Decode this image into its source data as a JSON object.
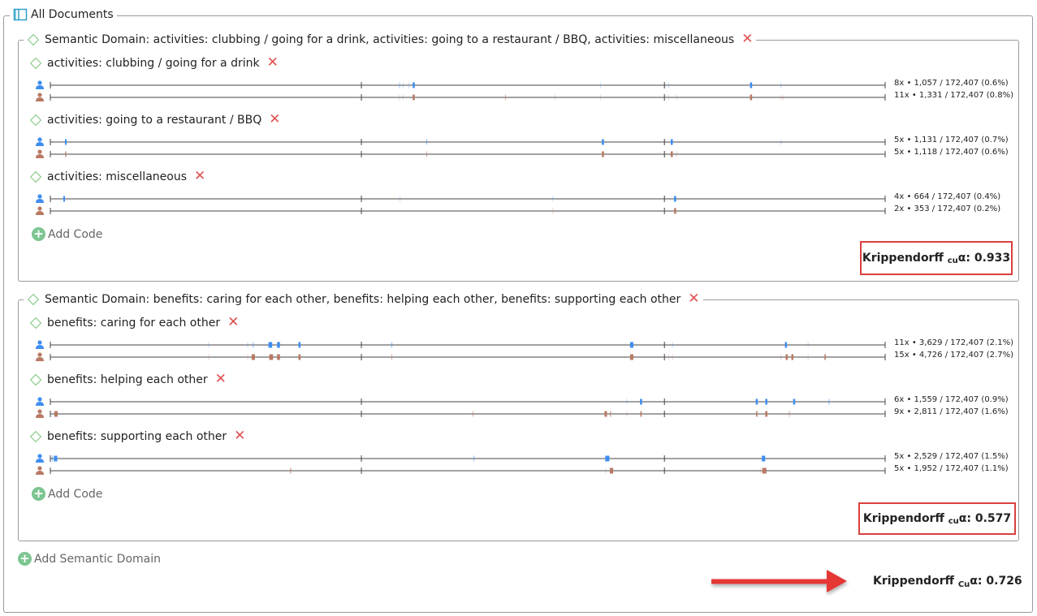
{
  "header": {
    "title": "All Documents"
  },
  "domains": [
    {
      "title": "Semantic Domain: activities: clubbing / going for a drink, activities: going to a restaurant / BBQ, activities: miscellaneous",
      "codes": [
        {
          "title": "activities: clubbing / going for a drink",
          "rows": [
            {
              "coder": "coder-blue",
              "stat": "8x • 1,057 / 172,407 (0.6%)",
              "marks": [
                [
                  0.4183,
                  0.0015,
                  "l"
                ],
                [
                  0.4226,
                  0.001,
                  "l"
                ],
                [
                  0.4291,
                  0.001,
                  "l"
                ],
                [
                  0.4353,
                  0.0025,
                  "d"
                ],
                [
                  0.6589,
                  0.001,
                  "l"
                ],
                [
                  0.7406,
                  0.001,
                  "l"
                ],
                [
                  0.8394,
                  0.0025,
                  "d"
                ],
                [
                  0.8753,
                  0.001,
                  "l"
                ]
              ]
            },
            {
              "coder": "coder-brown",
              "stat": "11x • 1,331 / 172,407 (0.8%)",
              "marks": [
                [
                  0.4183,
                  0.001,
                  "l"
                ],
                [
                  0.4226,
                  0.001,
                  "l"
                ],
                [
                  0.4353,
                  0.0025,
                  "d"
                ],
                [
                  0.5453,
                  0.001,
                  "m"
                ],
                [
                  0.6044,
                  0.001,
                  "l"
                ],
                [
                  0.6589,
                  0.001,
                  "l"
                ],
                [
                  0.7406,
                  0.001,
                  "l"
                ],
                [
                  0.7503,
                  0.001,
                  "l"
                ],
                [
                  0.8394,
                  0.0025,
                  "d"
                ],
                [
                  0.8753,
                  0.001,
                  "l"
                ],
                [
                  0.8782,
                  0.001,
                  "l"
                ]
              ]
            }
          ]
        },
        {
          "title": "activities: going to a restaurant / BBQ",
          "rows": [
            {
              "coder": "coder-blue",
              "stat": "5x • 1,131 / 172,407 (0.7%)",
              "marks": [
                [
                  0.0185,
                  0.002,
                  "d"
                ],
                [
                  0.4508,
                  0.001,
                  "m"
                ],
                [
                  0.6619,
                  0.0025,
                  "d"
                ],
                [
                  0.7444,
                  0.0025,
                  "d"
                ],
                [
                  0.8752,
                  0.001,
                  "l"
                ]
              ]
            },
            {
              "coder": "coder-brown",
              "stat": "5x • 1,118 / 172,407 (0.6%)",
              "marks": [
                [
                  0.0185,
                  0.002,
                  "m"
                ],
                [
                  0.4508,
                  0.001,
                  "m"
                ],
                [
                  0.6619,
                  0.0025,
                  "d"
                ],
                [
                  0.7444,
                  0.0025,
                  "d"
                ],
                [
                  0.7503,
                  0.001,
                  "l"
                ]
              ]
            }
          ]
        },
        {
          "title": "activities: miscellaneous",
          "rows": [
            {
              "coder": "coder-blue",
              "stat": "4x • 664 / 172,407 (0.4%)",
              "marks": [
                [
                  0.0165,
                  0.002,
                  "d"
                ],
                [
                  0.4188,
                  0.001,
                  "l"
                ],
                [
                  0.6019,
                  0.001,
                  "l"
                ],
                [
                  0.7484,
                  0.0025,
                  "d"
                ]
              ]
            },
            {
              "coder": "coder-brown",
              "stat": "2x • 353 / 172,407 (0.2%)",
              "marks": [
                [
                  0.6019,
                  0.001,
                  "l"
                ],
                [
                  0.7484,
                  0.0025,
                  "d"
                ]
              ]
            }
          ]
        }
      ],
      "add_code": "Add Code",
      "kripp": {
        "prefix": "Krippendorff ",
        "sub": "cu",
        "alpha": "α",
        "value": ": 0.933"
      }
    },
    {
      "title": "Semantic Domain: benefits: caring for each other, benefits: helping each other, benefits: supporting each other",
      "codes": [
        {
          "title": "benefits: caring for each other",
          "rows": [
            {
              "coder": "coder-blue",
              "stat": "11x • 3,629 / 172,407 (2.1%)",
              "marks": [
                [
                  0.1897,
                  0.001,
                  "l"
                ],
                [
                  0.2363,
                  0.001,
                  "l"
                ],
                [
                  0.2431,
                  0.001,
                  "m"
                ],
                [
                  0.2635,
                  0.0045,
                  "d"
                ],
                [
                  0.2733,
                  0.0035,
                  "d"
                ],
                [
                  0.2985,
                  0.0025,
                  "d"
                ],
                [
                  0.4091,
                  0.001,
                  "m"
                ],
                [
                  0.6964,
                  0.004,
                  "d"
                ],
                [
                  0.7454,
                  0.001,
                  "l"
                ],
                [
                  0.8812,
                  0.0025,
                  "d"
                ],
                [
                  0.9077,
                  0.001,
                  "l"
                ]
              ]
            },
            {
              "coder": "coder-brown",
              "stat": "15x • 4,726 / 172,407 (2.7%)",
              "marks": [
                [
                  0.1897,
                  0.001,
                  "l"
                ],
                [
                  0.2363,
                  0.001,
                  "l"
                ],
                [
                  0.2431,
                  0.004,
                  "d"
                ],
                [
                  0.2645,
                  0.0045,
                  "d"
                ],
                [
                  0.2733,
                  0.0035,
                  "d"
                ],
                [
                  0.2985,
                  0.0025,
                  "d"
                ],
                [
                  0.4091,
                  0.001,
                  "m"
                ],
                [
                  0.6964,
                  0.004,
                  "d"
                ],
                [
                  0.7406,
                  0.001,
                  "l"
                ],
                [
                  0.7454,
                  0.001,
                  "l"
                ],
                [
                  0.8821,
                  0.0025,
                  "d"
                ],
                [
                  0.8889,
                  0.0025,
                  "d"
                ],
                [
                  0.9281,
                  0.0015,
                  "d"
                ],
                [
                  0.9077,
                  0.001,
                  "l"
                ],
                [
                  0.8752,
                  0.001,
                  "l"
                ]
              ]
            }
          ]
        },
        {
          "title": "benefits: helping each other",
          "rows": [
            {
              "coder": "coder-blue",
              "stat": "6x • 1,559 / 172,407 (0.9%)",
              "marks": [
                [
                  0.7076,
                  0.0025,
                  "d"
                ],
                [
                  0.8462,
                  0.0025,
                  "d"
                ],
                [
                  0.8577,
                  0.0025,
                  "d"
                ],
                [
                  0.891,
                  0.0025,
                  "d"
                ],
                [
                  0.9329,
                  0.001,
                  "m"
                ],
                [
                  0.6905,
                  0.001,
                  "l"
                ]
              ]
            },
            {
              "coder": "coder-brown",
              "stat": "9x • 2,811 / 172,407 (1.6%)",
              "marks": [
                [
                  0.0068,
                  0.004,
                  "d"
                ],
                [
                  0.5064,
                  0.001,
                  "m"
                ],
                [
                  0.6653,
                  0.003,
                  "d"
                ],
                [
                  0.671,
                  0.0015,
                  "m"
                ],
                [
                  0.7076,
                  0.0015,
                  "d"
                ],
                [
                  0.8462,
                  0.0015,
                  "d"
                ],
                [
                  0.8577,
                  0.0025,
                  "d"
                ],
                [
                  0.8852,
                  0.001,
                  "m"
                ],
                [
                  0.6905,
                  0.001,
                  "l"
                ]
              ]
            }
          ]
        },
        {
          "title": "benefits: supporting each other",
          "rows": [
            {
              "coder": "coder-blue",
              "stat": "5x • 2,529 / 172,407 (1.5%)",
              "marks": [
                [
                  0.0063,
                  0.004,
                  "d"
                ],
                [
                  0.5074,
                  0.001,
                  "m"
                ],
                [
                  0.6672,
                  0.005,
                  "d"
                ],
                [
                  0.8543,
                  0.004,
                  "d"
                ],
                [
                  0.0024,
                  0.001,
                  "m"
                ]
              ]
            },
            {
              "coder": "coder-brown",
              "stat": "5x • 1,952 / 172,407 (1.1%)",
              "marks": [
                [
                  0.2878,
                  0.0015,
                  "m"
                ],
                [
                  0.6722,
                  0.004,
                  "d"
                ],
                [
                  0.8553,
                  0.005,
                  "d"
                ],
                [
                  0.6653,
                  0.001,
                  "l"
                ],
                [
                  0.8505,
                  0.001,
                  "l"
                ]
              ]
            }
          ]
        }
      ],
      "add_code": "Add Code",
      "kripp": {
        "prefix": "Krippendorff ",
        "sub": "cu",
        "alpha": "α",
        "value": ": 0.577"
      }
    }
  ],
  "add_domain": "Add Semantic Domain",
  "overall_kripp": {
    "prefix": "Krippendorff ",
    "sub": "Cu",
    "alpha": "α",
    "value": ": 0.726"
  },
  "colors": {
    "blue": "#3e8ef0",
    "brown": "#b97a64",
    "diamond": "#7cc47c",
    "plus": "#7dc591",
    "close": "#e05050",
    "highlight": "#d9403f",
    "arrow": "#e53935"
  }
}
